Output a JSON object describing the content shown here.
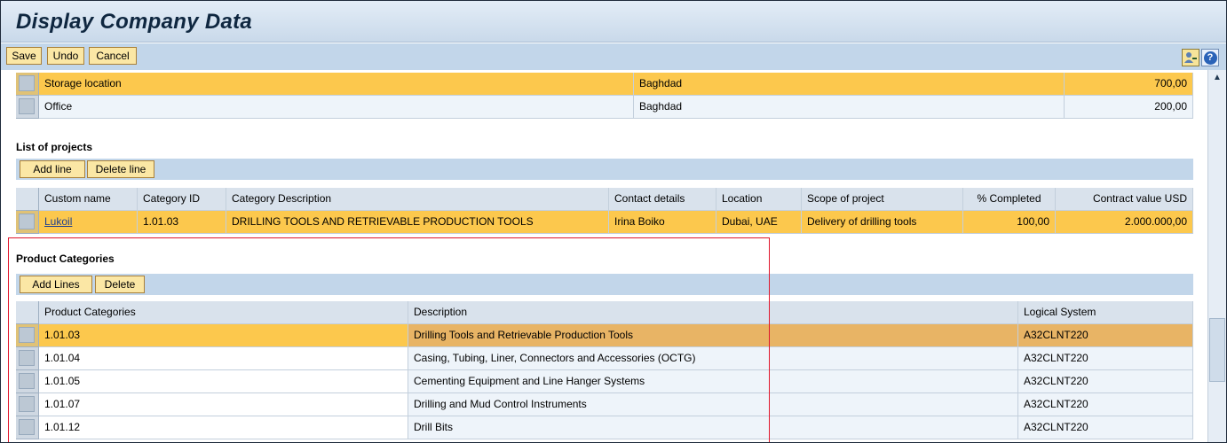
{
  "window": {
    "title": "Display Company Data"
  },
  "toolbar": {
    "save_label": "Save",
    "undo_label": "Undo",
    "cancel_label": "Cancel"
  },
  "top_table": {
    "rows": [
      {
        "name": "Storage location",
        "location": "Baghdad",
        "value": "700,00",
        "highlighted": true
      },
      {
        "name": "Office",
        "location": "Baghdad",
        "value": "200,00",
        "highlighted": false
      }
    ]
  },
  "projects": {
    "title": "List of projects",
    "add_label": "Add line",
    "delete_label": "Delete line",
    "columns": [
      "Custom name",
      "Category ID",
      "Category Description",
      "Contact details",
      "Location",
      "Scope of project",
      "% Completed",
      "Contract value USD"
    ],
    "rows": [
      {
        "custom_name": "Lukoil",
        "category_id": "1.01.03",
        "category_description": "DRILLING TOOLS AND RETRIEVABLE PRODUCTION TOOLS",
        "contact": "Irina Boiko",
        "location": "Dubai, UAE",
        "scope": "Delivery of drilling tools",
        "completed": "100,00",
        "contract_value": "2.000.000,00"
      }
    ]
  },
  "product_categories": {
    "title": "Product Categories",
    "add_label": "Add Lines",
    "delete_label": "Delete",
    "columns": [
      "Product Categories",
      "Description",
      "Logical System"
    ],
    "rows": [
      {
        "code": "1.01.03",
        "description": "Drilling Tools and Retrievable Production Tools",
        "system": "A32CLNT220"
      },
      {
        "code": "1.01.04",
        "description": "Casing, Tubing, Liner, Connectors and Accessories (OCTG)",
        "system": "A32CLNT220"
      },
      {
        "code": "1.01.05",
        "description": "Cementing Equipment and Line Hanger Systems",
        "system": "A32CLNT220"
      },
      {
        "code": "1.01.07",
        "description": "Drilling and Mud Control Instruments",
        "system": "A32CLNT220"
      },
      {
        "code": "1.01.12",
        "description": "Drill Bits",
        "system": "A32CLNT220"
      }
    ]
  },
  "colors": {
    "highlight": "#fcc84d",
    "toolbar": "#c2d6ea",
    "button": "#fbe7a5",
    "annotation_box": "#e0162b"
  },
  "icons": {
    "personalize": "user-settings-icon",
    "help": "help-icon",
    "scroll_up": "scroll-up-arrow-icon"
  }
}
